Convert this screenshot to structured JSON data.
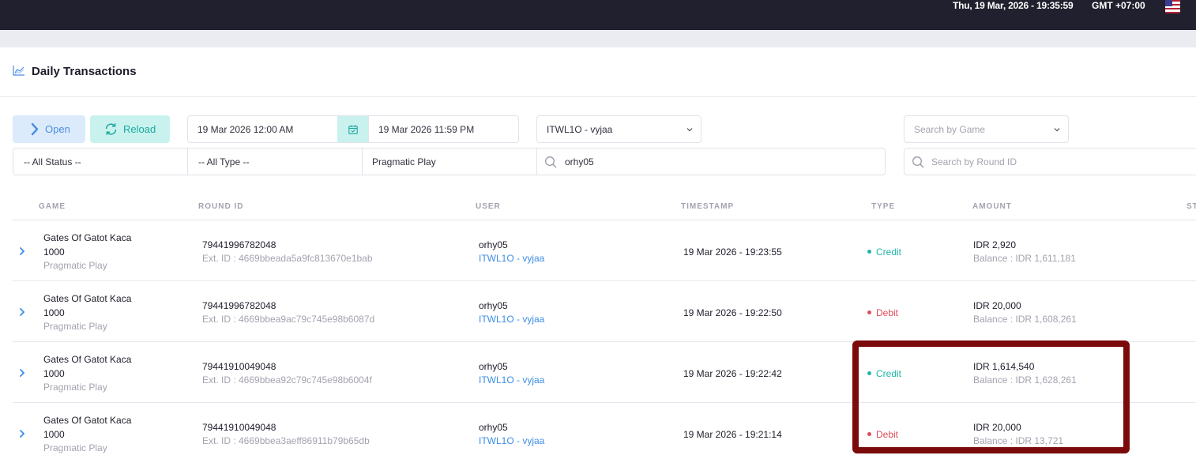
{
  "header": {
    "datetime": "Thu, 19 Mar, 2026 - 19:35:59",
    "timezone": "GMT +07:00",
    "flag_icon": "us-flag-icon"
  },
  "page": {
    "title": "Daily Transactions",
    "title_icon": "chart-line-icon"
  },
  "toolbar": {
    "open_label": "Open",
    "reload_label": "Reload",
    "date_from": "19 Mar 2026 12:00 AM",
    "date_to": "19 Mar 2026 11:59 PM",
    "agent_select": "ITWL1O - vyjaa",
    "game_search_placeholder": "Search by Game"
  },
  "filters": {
    "status": "-- All Status --",
    "type": "-- All Type --",
    "provider": "Pragmatic Play",
    "user_search": "orhy05",
    "round_search_placeholder": "Search by Round ID"
  },
  "table": {
    "columns": [
      "GAME",
      "ROUND ID",
      "USER",
      "TIMESTAMP",
      "TYPE",
      "AMOUNT",
      "ST"
    ],
    "rows": [
      {
        "game_name": "Gates Of Gatot Kaca",
        "game_variant": "1000",
        "provider": "Pragmatic Play",
        "round_id": "79441996782048",
        "ext_id": "Ext. ID : 4669bbeada5a9fc813670e1bab",
        "user": "orhy05",
        "agent": "ITWL1O - vyjaa",
        "timestamp": "19 Mar 2026 - 19:23:55",
        "type": "Credit",
        "amount": "IDR 2,920",
        "balance": "Balance : IDR 1,611,181"
      },
      {
        "game_name": "Gates Of Gatot Kaca",
        "game_variant": "1000",
        "provider": "Pragmatic Play",
        "round_id": "79441996782048",
        "ext_id": "Ext. ID : 4669bbea9ac79c745e98b6087d",
        "user": "orhy05",
        "agent": "ITWL1O - vyjaa",
        "timestamp": "19 Mar 2026 - 19:22:50",
        "type": "Debit",
        "amount": "IDR 20,000",
        "balance": "Balance : IDR 1,608,261"
      },
      {
        "game_name": "Gates Of Gatot Kaca",
        "game_variant": "1000",
        "provider": "Pragmatic Play",
        "round_id": "79441910049048",
        "ext_id": "Ext. ID : 4669bbea92c79c745e98b6004f",
        "user": "orhy05",
        "agent": "ITWL1O - vyjaa",
        "timestamp": "19 Mar 2026 - 19:22:42",
        "type": "Credit",
        "amount": "IDR 1,614,540",
        "balance": "Balance : IDR 1,628,261"
      },
      {
        "game_name": "Gates Of Gatot Kaca",
        "game_variant": "1000",
        "provider": "Pragmatic Play",
        "round_id": "79441910049048",
        "ext_id": "Ext. ID : 4669bbea3aeff86911b79b65db",
        "user": "orhy05",
        "agent": "ITWL1O - vyjaa",
        "timestamp": "19 Mar 2026 - 19:21:14",
        "type": "Debit",
        "amount": "IDR 20,000",
        "balance": "Balance : IDR 13,721"
      }
    ]
  },
  "colors": {
    "credit": "#1fb5a6",
    "debit": "#e04b5a",
    "highlight_border": "#7b0a0a"
  }
}
